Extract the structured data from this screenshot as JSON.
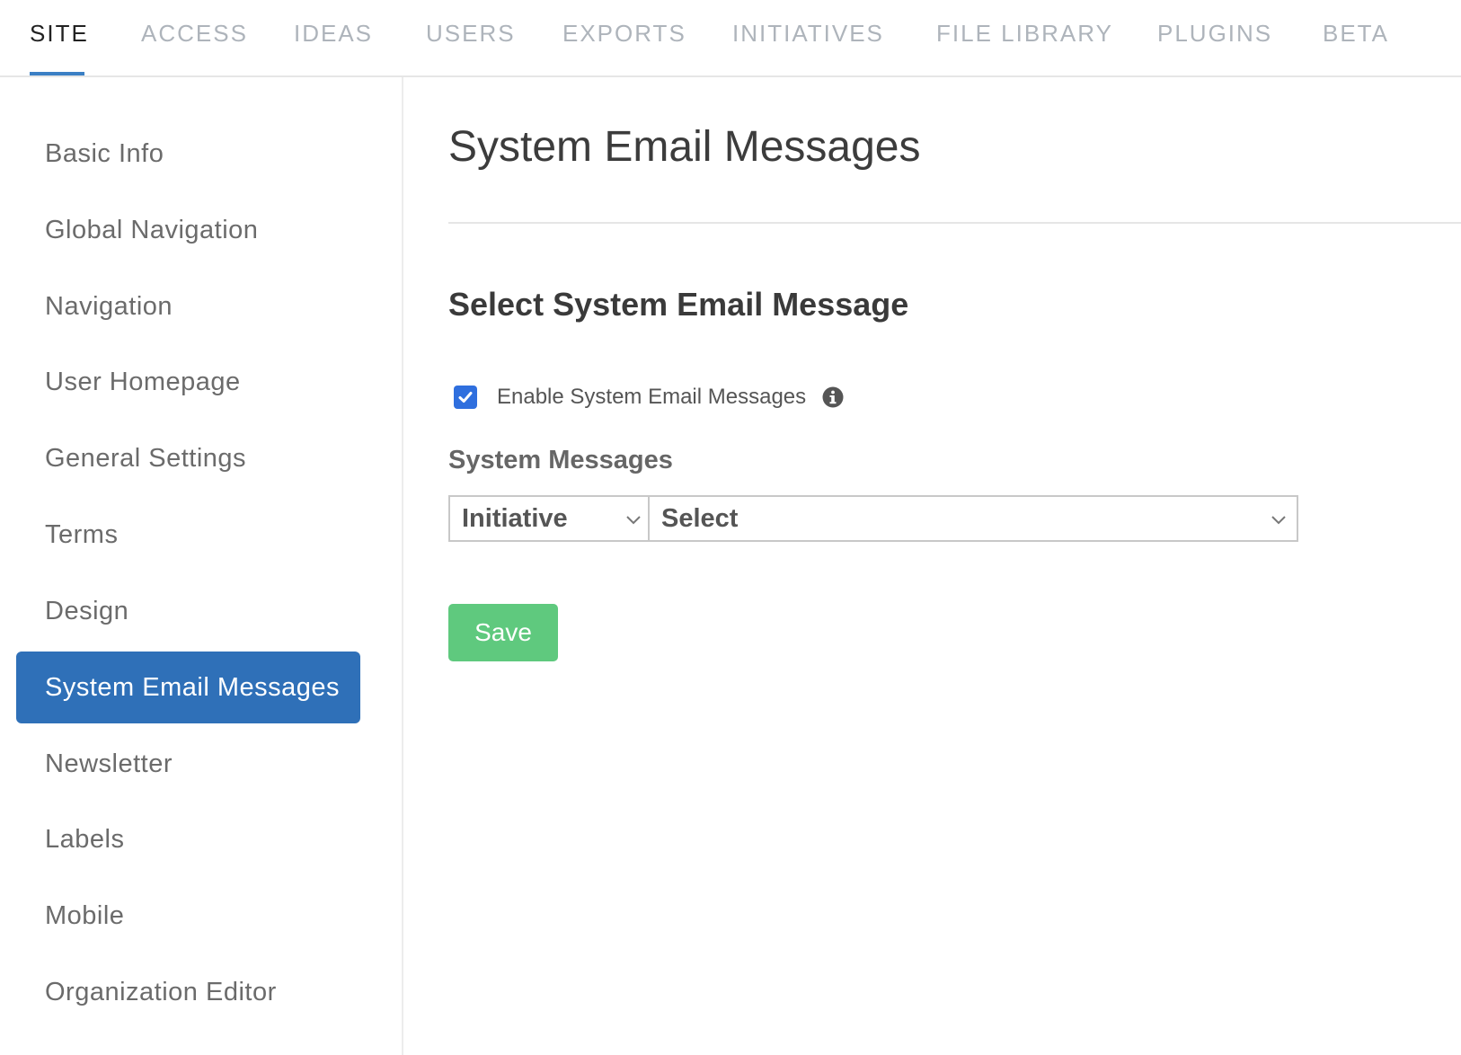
{
  "topnav": {
    "tabs": [
      {
        "label": "SITE",
        "active": true
      },
      {
        "label": "ACCESS",
        "active": false
      },
      {
        "label": "IDEAS",
        "active": false
      },
      {
        "label": "USERS",
        "active": false
      },
      {
        "label": "EXPORTS",
        "active": false
      },
      {
        "label": "INITIATIVES",
        "active": false
      },
      {
        "label": "FILE LIBRARY",
        "active": false
      },
      {
        "label": "PLUGINS",
        "active": false
      },
      {
        "label": "BETA",
        "active": false
      }
    ]
  },
  "sidebar": {
    "items": [
      {
        "label": "Basic Info",
        "active": false
      },
      {
        "label": "Global Navigation",
        "active": false
      },
      {
        "label": "Navigation",
        "active": false
      },
      {
        "label": "User Homepage",
        "active": false
      },
      {
        "label": "General Settings",
        "active": false
      },
      {
        "label": "Terms",
        "active": false
      },
      {
        "label": "Design",
        "active": false
      },
      {
        "label": "System Email Messages",
        "active": true
      },
      {
        "label": "Newsletter",
        "active": false
      },
      {
        "label": "Labels",
        "active": false
      },
      {
        "label": "Mobile",
        "active": false
      },
      {
        "label": "Organization Editor",
        "active": false
      }
    ]
  },
  "main": {
    "page_title": "System Email Messages",
    "section_title": "Select System Email Message",
    "enable_checkbox": {
      "label": "Enable System Email Messages",
      "checked": true,
      "icon": "info-icon"
    },
    "system_messages": {
      "label": "System Messages",
      "category_select": {
        "value": "Initiative",
        "icon": "chevron-down-icon"
      },
      "message_select": {
        "value": "Select",
        "icon": "chevron-down-icon"
      }
    },
    "save_label": "Save"
  },
  "colors": {
    "accent": "#3b7fc4",
    "active_item_bg": "#2f70b8",
    "checkbox": "#2f6fde",
    "save_button": "#5fc97e",
    "inactive_tab": "#aeb4bb"
  }
}
